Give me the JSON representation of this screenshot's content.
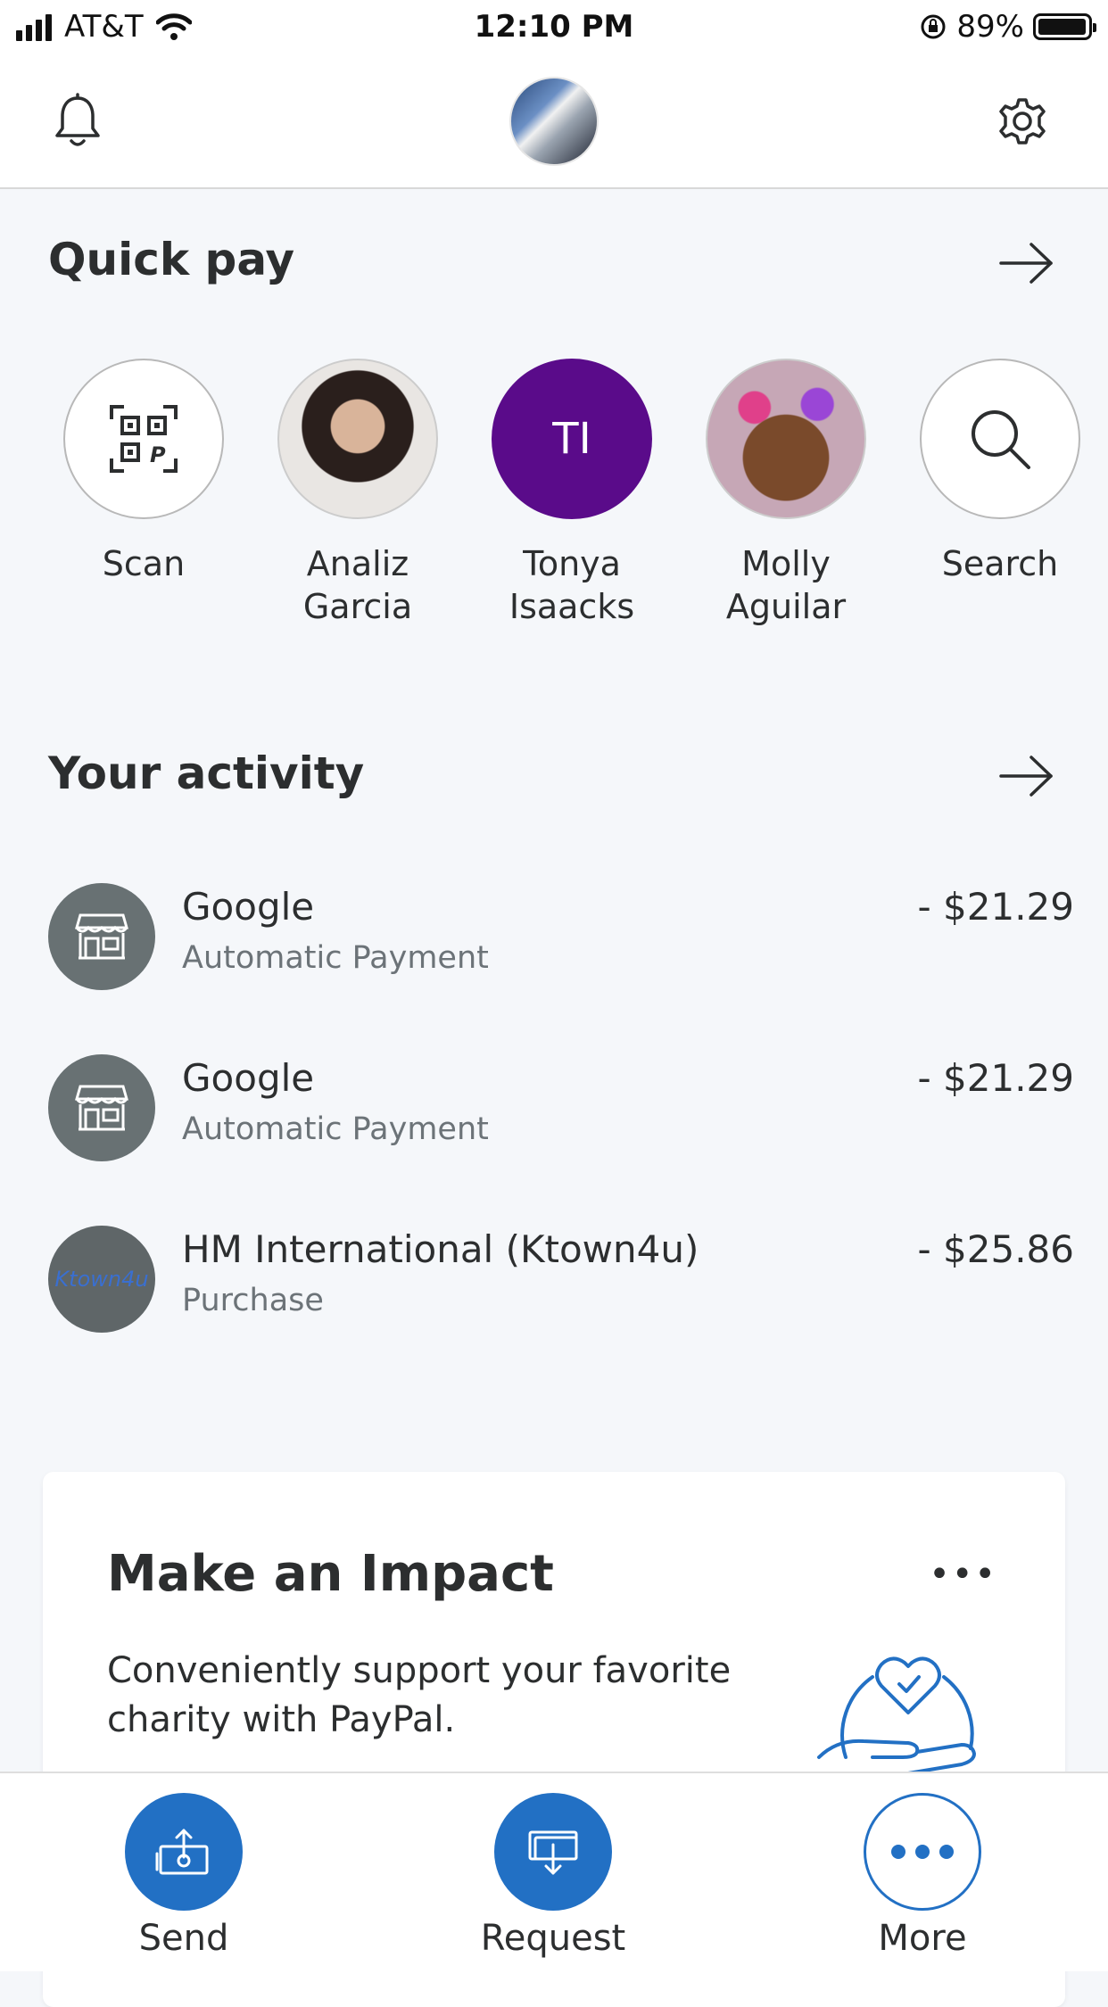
{
  "status_bar": {
    "carrier": "AT&T",
    "time": "12:10 PM",
    "battery": "89%"
  },
  "top_nav": {
    "bell_icon": "bell-icon",
    "gear_icon": "gear-icon"
  },
  "quick_pay": {
    "title": "Quick pay",
    "items": [
      {
        "label": "Scan",
        "icon": "qr-scan-icon"
      },
      {
        "label": "Analiz\nGarcia"
      },
      {
        "label": "Tonya\nIsaacks",
        "initials": "TI"
      },
      {
        "label": "Molly\nAguilar"
      },
      {
        "label": "Search",
        "icon": "search-icon"
      }
    ]
  },
  "activity": {
    "title": "Your activity",
    "rows": [
      {
        "name": "Google",
        "sub": "Automatic Payment",
        "amount": "- $21.29"
      },
      {
        "name": "Google",
        "sub": "Automatic Payment",
        "amount": "- $21.29"
      },
      {
        "name": "HM International (Ktown4u)",
        "sub": "Purchase",
        "amount": "- $25.86",
        "logo_text": "Ktown4u"
      }
    ]
  },
  "impact": {
    "title": "Make an Impact",
    "text": "Conveniently support your favorite charity with PayPal.",
    "menu": "•••"
  },
  "bottom_nav": {
    "send": "Send",
    "request": "Request",
    "more": "More"
  },
  "colors": {
    "accent": "#2270c4",
    "initials_bg": "#5a0b8a",
    "merchant_bg": "#687173"
  }
}
